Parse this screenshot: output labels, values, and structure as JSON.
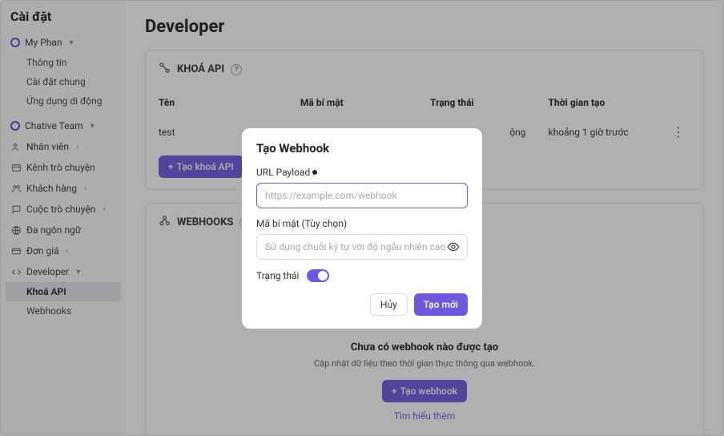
{
  "sidebar": {
    "title": "Cài đặt",
    "profile": {
      "name": "My Phan"
    },
    "profile_items": [
      "Thông tin",
      "Cài đặt chung",
      "Ứng dụng di động"
    ],
    "team": {
      "name": "Chative Team"
    },
    "nav": [
      {
        "label": "Nhân viên",
        "expand": "›"
      },
      {
        "label": "Kênh trò chuyện",
        "expand": ""
      },
      {
        "label": "Khách hàng",
        "expand": "›"
      },
      {
        "label": "Cuộc trò chuyện",
        "expand": "›"
      },
      {
        "label": "Đa ngôn ngữ",
        "expand": ""
      },
      {
        "label": "Đơn giá",
        "expand": "›"
      }
    ],
    "dev": {
      "label": "Developer",
      "items": [
        "Khoá API",
        "Webhooks"
      ]
    }
  },
  "main": {
    "title": "Developer",
    "api": {
      "heading": "KHOÁ API",
      "cols": {
        "name": "Tên",
        "secret": "Mã bí mật",
        "status": "Trạng thái",
        "created": "Thời gian tạo"
      },
      "row": {
        "name": "test",
        "status_suffix": "ộng",
        "created": "khoảng 1 giờ trước"
      },
      "btn": "Tạo khoá API"
    },
    "webhooks": {
      "heading": "WEBHOOKS",
      "empty_title": "Chưa có webhook nào được tạo",
      "empty_sub": "Cập nhật dữ liệu theo thời gian thực thông qua webhook.",
      "btn": "Tạo webhook",
      "link": "Tìm hiểu thêm"
    }
  },
  "modal": {
    "title": "Tạo Webhook",
    "url_label": "URL Payload",
    "url_placeholder": "https://example.com/webhook",
    "secret_label": "Mã bí mật (Tùy chọn)",
    "secret_placeholder": "Sử dụng chuỗi ký tự với độ ngẫu nhiên cao",
    "status_label": "Trạng thái",
    "cancel": "Hủy",
    "submit": "Tạo mới"
  }
}
